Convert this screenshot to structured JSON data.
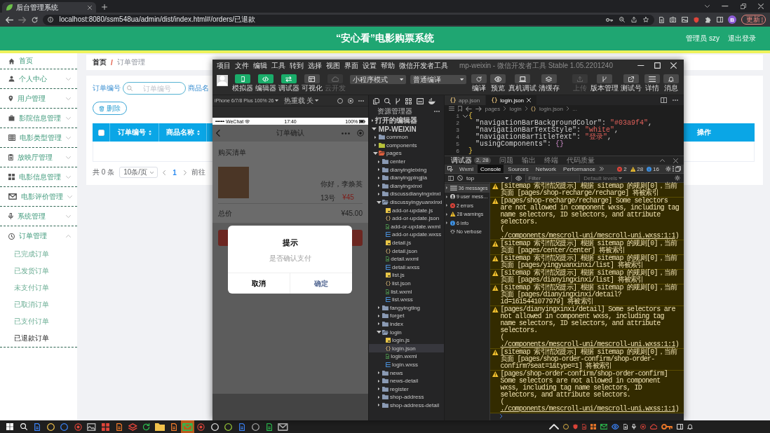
{
  "browser": {
    "tab_title": "后台管理系统",
    "url": "localhost:8080/ssm548ua/admin/dist/index.html#/orders/已退款",
    "profile": "B",
    "update_button": "更新"
  },
  "header": {
    "title": "“安心看”电影购票系统",
    "user": "管理员 szy",
    "logout": "退出登录"
  },
  "sidebar": {
    "items": [
      {
        "label": "首页",
        "kind": "link"
      },
      {
        "label": "个人中心",
        "kind": "menu",
        "expanded": false
      },
      {
        "label": "用户管理",
        "kind": "menu",
        "expanded": false
      },
      {
        "label": "影院信息管理",
        "kind": "menu",
        "expanded": false
      },
      {
        "label": "电影类型管理",
        "kind": "menu",
        "expanded": false
      },
      {
        "label": "放映厅管理",
        "kind": "menu",
        "expanded": false
      },
      {
        "label": "电影信息管理",
        "kind": "menu",
        "expanded": false
      },
      {
        "label": "电影评价管理",
        "kind": "menu",
        "expanded": false
      },
      {
        "label": "系统管理",
        "kind": "menu",
        "expanded": false
      },
      {
        "label": "订单管理",
        "kind": "menu",
        "expanded": true,
        "children": [
          {
            "label": "已完成订单",
            "selected": false
          },
          {
            "label": "已发货订单",
            "selected": false
          },
          {
            "label": "未支付订单",
            "selected": false
          },
          {
            "label": "已取消订单",
            "selected": false
          },
          {
            "label": "已支付订单",
            "selected": false
          },
          {
            "label": "已退款订单",
            "selected": true
          }
        ]
      }
    ]
  },
  "breadcrumb": {
    "items": [
      "首页",
      "订单管理"
    ],
    "separator": "/"
  },
  "search": {
    "order_no": {
      "label": "订单编号",
      "placeholder": "订单编号"
    },
    "product_label": "商品名"
  },
  "delete_button": "删除",
  "table": {
    "select_all": {
      "checked": false
    },
    "columns": [
      {
        "label": "订单编号",
        "sortable": true
      },
      {
        "label": "商品名称",
        "sortable": true
      },
      {
        "label": "操作",
        "sortable": false
      }
    ]
  },
  "pagination": {
    "total": "共 0 条",
    "page_size": "10条/页",
    "pages": [
      {
        "label": "1",
        "selected": true
      }
    ],
    "goto": "前往"
  },
  "devtools": {
    "menu": [
      "项目",
      "文件",
      "编辑",
      "工具",
      "转到",
      "选择",
      "视图",
      "界面",
      "设置",
      "帮助",
      "微信开发者工具"
    ],
    "title": "mp-weixin - 微信开发者工具 Stable 1.05.2201240",
    "toolbar": {
      "toggles": [
        {
          "label": "模拟器",
          "on": true,
          "disabled": false
        },
        {
          "label": "编辑器",
          "on": true,
          "disabled": false
        },
        {
          "label": "调试器",
          "on": true,
          "disabled": false
        },
        {
          "label": "可视化",
          "on": false,
          "disabled": false
        },
        {
          "label": "云开发",
          "on": false,
          "disabled": true
        }
      ],
      "mode": "小程序模式",
      "compile": "普通编译",
      "actions": [
        "编译",
        "预览",
        "真机调试",
        "清缓存"
      ],
      "right": [
        {
          "label": "上传",
          "disabled": true
        },
        {
          "label": "版本管理",
          "disabled": false
        },
        {
          "label": "测试号",
          "disabled": false
        },
        {
          "label": "详情",
          "disabled": false
        },
        {
          "label": "消息",
          "disabled": false
        }
      ]
    }
  },
  "simulator": {
    "device": "iPhone 6/7/8 Plus 100% 26",
    "hot_reload": "热重载 关",
    "status_bar": {
      "carrier": "WeChat",
      "time": "17:40",
      "battery": "100%"
    },
    "nav_title": "订单确认",
    "section_title": "购买清单",
    "item": {
      "title": "你好，李焕英",
      "seat": "13号",
      "price": "¥45"
    },
    "total_label": "总价",
    "total": "¥45.00",
    "dialog": {
      "title": "提示",
      "message": "是否确认支付",
      "cancel": "取消",
      "confirm": "确定"
    }
  },
  "explorer": {
    "title": "资源管理器",
    "sections": [
      {
        "label": "打开的编辑器",
        "expanded": false
      },
      {
        "label": "MP-WEIXIN",
        "expanded": true,
        "children": [
          {
            "label": "common",
            "kind": "folder",
            "color": "#8a9ab4",
            "expanded": false,
            "selected": false
          },
          {
            "label": "components",
            "kind": "folder",
            "color": "#b8c23a",
            "expanded": false,
            "selected": false
          },
          {
            "label": "pages",
            "kind": "folder",
            "color": "#e0603e",
            "expanded": true,
            "selected": false,
            "children": [
              {
                "label": "center",
                "kind": "folder",
                "color": "#8a9ab4",
                "expanded": false,
                "selected": false
              },
              {
                "label": "dianyingleixing",
                "kind": "folder",
                "color": "#8a9ab4",
                "expanded": false,
                "selected": false
              },
              {
                "label": "dianyingpingjia",
                "kind": "folder",
                "color": "#8a9ab4",
                "expanded": false,
                "selected": false
              },
              {
                "label": "dianyingxinxi",
                "kind": "folder",
                "color": "#8a9ab4",
                "expanded": false,
                "selected": false
              },
              {
                "label": "discussdianyingxinxi",
                "kind": "folder",
                "color": "#8a9ab4",
                "expanded": false,
                "selected": false
              },
              {
                "label": "discussyingyuanxinxi",
                "kind": "folder",
                "color": "#8a9ab4",
                "expanded": true,
                "selected": false,
                "children": [
                  {
                    "label": "add-or-update.js",
                    "kind": "js",
                    "selected": false
                  },
                  {
                    "label": "add-or-update.json",
                    "kind": "json",
                    "selected": false
                  },
                  {
                    "label": "add-or-update.wxml",
                    "kind": "wxml",
                    "selected": false
                  },
                  {
                    "label": "add-or-update.wxss",
                    "kind": "wxss",
                    "selected": false
                  },
                  {
                    "label": "detail.js",
                    "kind": "js",
                    "selected": false
                  },
                  {
                    "label": "detail.json",
                    "kind": "json",
                    "selected": false
                  },
                  {
                    "label": "detail.wxml",
                    "kind": "wxml",
                    "selected": false
                  },
                  {
                    "label": "detail.wxss",
                    "kind": "wxss",
                    "selected": false
                  },
                  {
                    "label": "list.js",
                    "kind": "js",
                    "selected": false
                  },
                  {
                    "label": "list.json",
                    "kind": "json",
                    "selected": false
                  },
                  {
                    "label": "list.wxml",
                    "kind": "wxml",
                    "selected": false
                  },
                  {
                    "label": "list.wxss",
                    "kind": "wxss",
                    "selected": false
                  }
                ]
              },
              {
                "label": "fangyingting",
                "kind": "folder",
                "color": "#8a9ab4",
                "expanded": false,
                "selected": false
              },
              {
                "label": "forget",
                "kind": "folder",
                "color": "#8a9ab4",
                "expanded": false,
                "selected": false
              },
              {
                "label": "index",
                "kind": "folder",
                "color": "#8a9ab4",
                "expanded": false,
                "selected": false
              },
              {
                "label": "login",
                "kind": "folder",
                "color": "#8a9ab4",
                "expanded": true,
                "selected": false,
                "children": [
                  {
                    "label": "login.js",
                    "kind": "js",
                    "selected": false
                  },
                  {
                    "label": "login.json",
                    "kind": "json",
                    "selected": true
                  },
                  {
                    "label": "login.wxml",
                    "kind": "wxml",
                    "selected": false
                  },
                  {
                    "label": "login.wxss",
                    "kind": "wxss",
                    "selected": false
                  }
                ]
              },
              {
                "label": "news",
                "kind": "folder",
                "color": "#8a9ab4",
                "expanded": false,
                "selected": false
              },
              {
                "label": "news-detail",
                "kind": "folder",
                "color": "#8a9ab4",
                "expanded": false,
                "selected": false
              },
              {
                "label": "register",
                "kind": "folder",
                "color": "#8a9ab4",
                "expanded": false,
                "selected": false
              },
              {
                "label": "shop-address",
                "kind": "folder",
                "color": "#8a9ab4",
                "expanded": false,
                "selected": false
              },
              {
                "label": "shop-address-detail",
                "kind": "folder",
                "color": "#8a9ab4",
                "expanded": false,
                "selected": false
              }
            ]
          }
        ]
      }
    ]
  },
  "editor": {
    "tabs": [
      {
        "label": "app.json",
        "selected": false
      },
      {
        "label": "login.json",
        "selected": true
      }
    ],
    "breadcrumb": [
      "pages",
      "login",
      "login.json",
      "..."
    ],
    "lines": [
      {
        "number": "1",
        "tokens": [
          {
            "kind": "open",
            "text": "{"
          }
        ]
      },
      {
        "number": "2",
        "tokens": [
          {
            "kind": "key",
            "text": "\"navigationBarBackgroundColor\""
          },
          {
            "kind": "punct",
            "text": ": "
          },
          {
            "kind": "string",
            "text": "\"#03a9f4\""
          },
          {
            "kind": "punct",
            "text": ","
          }
        ]
      },
      {
        "number": "3",
        "tokens": [
          {
            "kind": "key",
            "text": "\"navigationBarTextStyle\""
          },
          {
            "kind": "punct",
            "text": ": "
          },
          {
            "kind": "string",
            "text": "\"white\""
          },
          {
            "kind": "punct",
            "text": ","
          }
        ]
      },
      {
        "number": "4",
        "tokens": [
          {
            "kind": "key",
            "text": "\"navigationBarTitleText\""
          },
          {
            "kind": "punct",
            "text": ": "
          },
          {
            "kind": "string",
            "text": "\"登录\""
          },
          {
            "kind": "punct",
            "text": ","
          }
        ]
      },
      {
        "number": "5",
        "tokens": [
          {
            "kind": "key",
            "text": "\"usingComponents\""
          },
          {
            "kind": "punct",
            "text": ": "
          },
          {
            "kind": "object",
            "text": "{}"
          }
        ]
      },
      {
        "number": "6",
        "tokens": [
          {
            "kind": "close",
            "text": "}"
          }
        ]
      }
    ]
  },
  "debugger": {
    "panel_tabs": [
      {
        "label": "调试器",
        "badge": "2, 28",
        "selected": true
      },
      {
        "label": "问题",
        "selected": false
      },
      {
        "label": "输出",
        "selected": false
      },
      {
        "label": "终端",
        "selected": false
      },
      {
        "label": "代码质量",
        "selected": false
      }
    ],
    "tabs": [
      {
        "label": "Wxml",
        "selected": false
      },
      {
        "label": "Console",
        "selected": true
      },
      {
        "label": "Sources",
        "selected": false
      },
      {
        "label": "Network",
        "selected": false
      },
      {
        "label": "Performance",
        "selected": false
      }
    ],
    "counts": [
      {
        "kind": "error",
        "value": "2"
      },
      {
        "kind": "warning",
        "value": "28"
      },
      {
        "kind": "info",
        "value": "16"
      }
    ],
    "context": "top",
    "filter": {
      "placeholder": "Filter"
    },
    "levels": "Default levels",
    "sidebar": [
      {
        "kind": "all",
        "label": "36 messages",
        "selected": true
      },
      {
        "kind": "user",
        "label": "9 user mess…",
        "selected": false
      },
      {
        "kind": "error",
        "label": "2 errors",
        "selected": false
      },
      {
        "kind": "warning",
        "label": "28 warnings",
        "selected": false
      },
      {
        "kind": "info",
        "label": "6 info",
        "selected": false
      },
      {
        "kind": "verbose",
        "label": "No verbose",
        "selected": false
      }
    ],
    "messages": [
      {
        "kind": "warning",
        "text": "[sitemap 索引情况提示] 根据 sitemap 的规则[0]，当前页面 [pages/shop-recharge/recharge] 将被索引"
      },
      {
        "kind": "warning",
        "text": "[pages/shop-recharge/recharge] Some selectors are not allowed in component wxss, including tag name selectors, ID selectors, and attribute selectors.(",
        "link": "./components/mescroll-uni/mescroll-uni.wxss:1:1",
        "tail": ")"
      },
      {
        "kind": "warning",
        "text": "[sitemap 索引情况提示] 根据 sitemap 的规则[0]，当前页面 [pages/center/center] 将被索引"
      },
      {
        "kind": "warning",
        "text": "[sitemap 索引情况提示] 根据 sitemap 的规则[0]，当前页面 [pages/yingyuanxinxi/list] 将被索引"
      },
      {
        "kind": "warning",
        "text": "[sitemap 索引情况提示] 根据 sitemap 的规则[0]，当前页面 [pages/dianyingxinxi/list] 将被索引"
      },
      {
        "kind": "warning",
        "text": "[sitemap 索引情况提示] 根据 sitemap 的规则[0]，当前页面 [pages/dianyingxinxi/detail?id=1615441077979] 将被索引"
      },
      {
        "kind": "warning",
        "text": "[pages/dianyingxinxi/detail] Some selectors are not allowed in component wxss, including tag name selectors, ID selectors, and attribute selectors.(",
        "link": "./components/mescroll-uni/mescroll-uni.wxss:1:1",
        "tail": ")"
      },
      {
        "kind": "warning",
        "text": "[sitemap 索引情况提示] 根据 sitemap 的规则[0]，当前页面 [pages/shop-order-confirm/shop-order-confirm?seat=1&type=1] 将被索引"
      },
      {
        "kind": "warning",
        "text": "[pages/shop-order-confirm/shop-order-confirm] Some selectors are not allowed in component wxss, including tag name selectors, ID selectors, and attribute selectors.(",
        "link": "./components/mescroll-uni/mescroll-uni.wxss:1:1",
        "tail": ")"
      }
    ]
  },
  "taskbar": {
    "apps": [
      {
        "selected": false
      },
      {
        "selected": false
      },
      {
        "selected": false
      },
      {
        "selected": false
      },
      {
        "selected": false
      },
      {
        "selected": false
      },
      {
        "selected": false
      },
      {
        "selected": false
      },
      {
        "selected": false
      },
      {
        "selected": false
      },
      {
        "selected": false
      },
      {
        "selected": true
      },
      {
        "selected": false
      },
      {
        "selected": false
      },
      {
        "selected": false
      },
      {
        "selected": false
      },
      {
        "selected": false
      },
      {
        "selected": false
      },
      {
        "selected": false
      }
    ]
  }
}
